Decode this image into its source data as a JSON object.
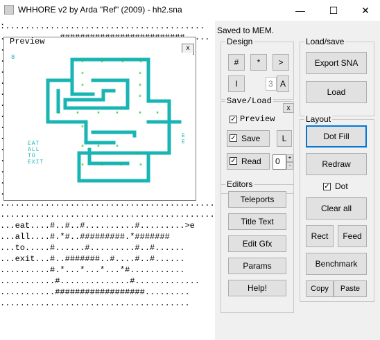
{
  "window": {
    "title": "WHHORE v2  by Arda \"Ref\" (2009) - hh2.sna",
    "minimize": "—",
    "maximize": "☐",
    "close": "✕"
  },
  "grid": {
    "lines": [
      ":........................................",
      "............#########################.....",
      ".....................................",
      "......................................",
      "......................................",
      "......................................",
      "......................................",
      "......................................",
      "......................................",
      "......................................",
      "......................................",
      "......................................",
      "......................................",
      "......................................",
      "......................................",
      "......................................",
      "......................................................##",
      "......................................................>e",
      "...eat....#..#..#..........#.........>e",
      "...all....#.*#..#########.*#######",
      "...to.....#......#.........#..#......",
      "...exit...#..#######..#....#..#......",
      "..........#.*...*...*...*#...........",
      "...........#..............#.............",
      "...........##################.........",
      "......................................"
    ]
  },
  "preview": {
    "title": "Preview",
    "close": "x",
    "corner_digit": "8",
    "side_text": [
      "EAT",
      "ALL",
      "TO",
      "EXIT"
    ],
    "exit_letters": [
      "E",
      "E"
    ],
    "maze_color": "#19b5b5",
    "star_color": "#21c021",
    "text_color": "#19b5b5"
  },
  "status": "Saved to MEM.",
  "design": {
    "label": "Design",
    "hash": "#",
    "star": "*",
    "gt": ">",
    "bar": "I",
    "count": "3",
    "a": "A"
  },
  "saveload": {
    "label": "Save/Load",
    "close": "x",
    "preview_label": "Preview",
    "save_label": "Save",
    "l_label": "L",
    "read_label": "Read",
    "read_value": "0",
    "spin_up": "+",
    "spin_down": "-"
  },
  "editors": {
    "label": "Editors",
    "teleports": "Teleports",
    "title_text": "Title Text",
    "edit_gfx": "Edit Gfx",
    "params": "Params",
    "help": "Help!"
  },
  "loadsave": {
    "label": "Load/save",
    "export": "Export SNA",
    "load": "Load"
  },
  "layout": {
    "label": "Layout",
    "dot_fill": "Dot Fill",
    "redraw": "Redraw",
    "dot_label": "Dot",
    "clear_all": "Clear all",
    "rect": "Rect",
    "feed": "Feed",
    "benchmark": "Benchmark",
    "copy": "Copy",
    "paste": "Paste"
  }
}
